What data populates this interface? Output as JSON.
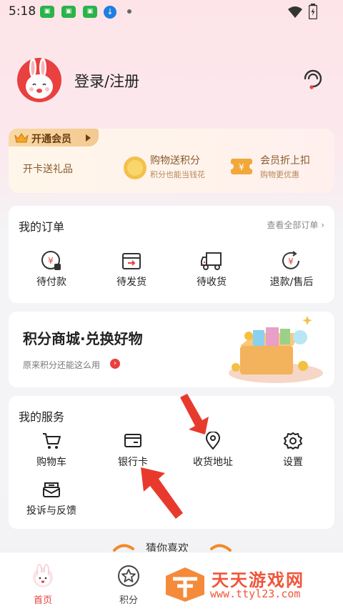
{
  "status_bar": {
    "time": "5:18"
  },
  "header": {
    "login_label": "登录/注册"
  },
  "vip": {
    "tag_label": "开通会员",
    "gift_label": "开卡送礼品",
    "feature1_title": "购物送积分",
    "feature1_sub": "积分也能当钱花",
    "feature2_title": "会员折上扣",
    "feature2_sub": "购物更优惠",
    "coupon_symbol": "¥"
  },
  "orders": {
    "title": "我的订单",
    "view_all": "查看全部订单",
    "items": [
      {
        "label": "待付款"
      },
      {
        "label": "待发货"
      },
      {
        "label": "待收货"
      },
      {
        "label": "退款/售后"
      }
    ]
  },
  "mall": {
    "title": "积分商城·兑换好物",
    "subtitle": "原来积分还能这么用"
  },
  "services": {
    "title": "我的服务",
    "items": [
      {
        "label": "购物车"
      },
      {
        "label": "银行卡"
      },
      {
        "label": "收货地址"
      },
      {
        "label": "设置"
      },
      {
        "label": "投诉与反馈"
      }
    ]
  },
  "recommend": {
    "label": "猜你喜欢"
  },
  "tabs": [
    {
      "label": "首页"
    },
    {
      "label": "积分"
    }
  ],
  "watermark": {
    "title": "天天游戏网",
    "url": "www.ttyl23.com"
  },
  "colors": {
    "accent": "#e8413f",
    "vip_text": "#8a5a2b",
    "tab_active": "#e8413f"
  }
}
